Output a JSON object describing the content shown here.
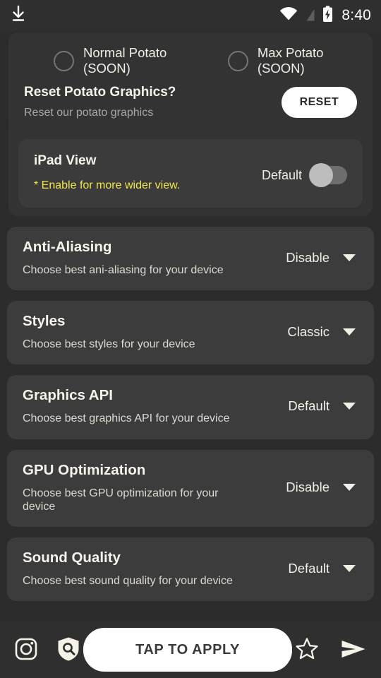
{
  "status_bar": {
    "time": "8:40",
    "icons": [
      "download-icon",
      "wifi-icon",
      "signal-off-icon",
      "battery-charging-icon"
    ]
  },
  "potato_card": {
    "options": [
      {
        "label": "Normal Potato (SOON)",
        "selected": false
      },
      {
        "label": "Max Potato (SOON)",
        "selected": false
      }
    ],
    "reset_title": "Reset Potato  Graphics?",
    "reset_subtitle": "Reset our potato graphics",
    "reset_button": "RESET"
  },
  "ipad_card": {
    "title": "iPad View",
    "subtitle": "* Enable for more wider view.",
    "toggle_label": "Default",
    "toggle_on": false,
    "subtitle_color": "#f2e54b"
  },
  "settings": [
    {
      "title": "Anti-Aliasing",
      "subtitle": "Choose best ani-aliasing for your device",
      "value": "Disable"
    },
    {
      "title": "Styles",
      "subtitle": "Choose best styles for your device",
      "value": "Classic"
    },
    {
      "title": "Graphics API",
      "subtitle": "Choose best graphics API for your device",
      "value": "Default"
    },
    {
      "title": "GPU Optimization",
      "subtitle": "Choose best GPU optimization for your device",
      "value": "Disable"
    },
    {
      "title": "Sound Quality",
      "subtitle": "Choose best sound quality for your device",
      "value": "Default"
    }
  ],
  "bottom_bar": {
    "instagram_icon": "instagram-icon",
    "shield_search_icon": "shield-search-icon",
    "apply_button": "TAP TO APPLY",
    "star_icon": "star-outline-icon",
    "send_icon": "send-icon"
  },
  "colors": {
    "page_bg": "#2c2c2c",
    "card_bg": "#3c3c3c",
    "group_bg": "#333333",
    "accent_white": "#ffffff",
    "warning_yellow": "#f2e54b",
    "text_primary": "#f6f3eb",
    "text_secondary": "#a8a8a8"
  }
}
